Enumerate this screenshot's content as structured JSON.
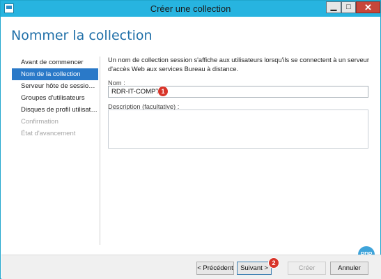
{
  "window": {
    "title": "Créer une collection",
    "controls": {
      "minimize": "▁",
      "maximize": "□",
      "close": "✕"
    }
  },
  "page": {
    "heading": "Nommer la collection"
  },
  "nav": {
    "items": [
      {
        "label": "Avant de commencer",
        "state": "normal"
      },
      {
        "label": "Nom de la collection",
        "state": "selected"
      },
      {
        "label": "Serveur hôte de session B...",
        "state": "normal"
      },
      {
        "label": "Groupes d'utilisateurs",
        "state": "normal"
      },
      {
        "label": "Disques de profil utilisateur",
        "state": "normal"
      },
      {
        "label": "Confirmation",
        "state": "disabled"
      },
      {
        "label": "État d'avancement",
        "state": "disabled"
      }
    ]
  },
  "main": {
    "intro": "Un nom de collection session s'affiche aux utilisateurs lorsqu'ils se connectent à un serveur d'accès Web aux services Bureau à distance.",
    "name_label": "Nom :",
    "name_value": "RDR-IT-COMPTA",
    "description_label": "Description (facultative) :",
    "description_value": ""
  },
  "annotations": {
    "marker_1": "1",
    "marker_2": "2"
  },
  "buttons": {
    "previous": "< Précédent",
    "next": "Suivant >",
    "create": "Créer",
    "cancel": "Annuler"
  },
  "watermark": {
    "text": "RDR"
  },
  "colors": {
    "titlebar": "#27b4e0",
    "accent": "#1f6fa8",
    "selected_nav": "#2a79c8",
    "badge": "#d8352a",
    "close_button": "#c7463a"
  }
}
